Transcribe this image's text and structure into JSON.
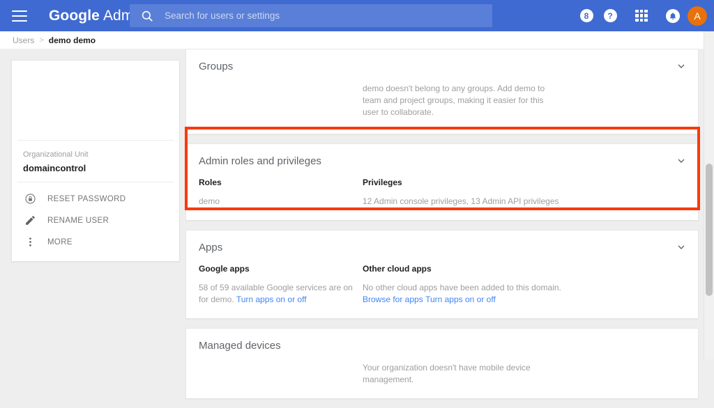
{
  "topbar": {
    "menu_icon": "hamburger-menu-icon",
    "brand_google": "Google",
    "brand_product": "Admin",
    "search": {
      "icon": "search-icon",
      "placeholder": "Search for users or settings",
      "value": ""
    },
    "support_badge": "8",
    "help_label": "?",
    "apps_icon": "apps-grid-icon",
    "notifications_icon": "bell-icon",
    "avatar_initial": "A",
    "bg_color": "#3f6ad1",
    "search_bg_color": "#5a7fd8",
    "avatar_color": "#e8710a"
  },
  "breadcrumb": {
    "parent": "Users",
    "separator": ">",
    "current": "demo demo"
  },
  "profile_card": {
    "org_unit_label": "Organizational Unit",
    "org_unit_value": "domaincontrol",
    "actions": [
      {
        "icon": "lock-reset-icon",
        "label": "RESET PASSWORD"
      },
      {
        "icon": "pencil-icon",
        "label": "RENAME USER"
      },
      {
        "icon": "more-vert-icon",
        "label": "MORE"
      }
    ]
  },
  "sections": {
    "groups": {
      "title": "Groups",
      "chevron": "chevron-down-icon",
      "empty_text": "demo doesn't belong to any groups. Add demo to team and project groups, making it easier for this user to collaborate."
    },
    "admin_roles": {
      "title": "Admin roles and privileges",
      "chevron": "chevron-down-icon",
      "roles_heading": "Roles",
      "roles_value": "demo",
      "privileges_heading": "Privileges",
      "privileges_value": "12 Admin console privileges, 13 Admin API privileges",
      "highlight_color": "#f93a0b"
    },
    "apps": {
      "title": "Apps",
      "chevron": "chevron-down-icon",
      "google_apps_heading": "Google apps",
      "google_apps_text": "58 of 59 available Google services are on for demo. ",
      "google_apps_link": "Turn apps on or off",
      "other_apps_heading": "Other cloud apps",
      "other_apps_text": "No other cloud apps have been added to this domain. ",
      "other_apps_link1": "Browse for apps",
      "other_apps_link2": "Turn apps on or off",
      "link_color": "#4285f4"
    },
    "managed_devices": {
      "title": "Managed devices",
      "empty_text": "Your organization doesn't have mobile device management."
    }
  },
  "scrollbar": {
    "name": "vertical-scrollbar"
  }
}
